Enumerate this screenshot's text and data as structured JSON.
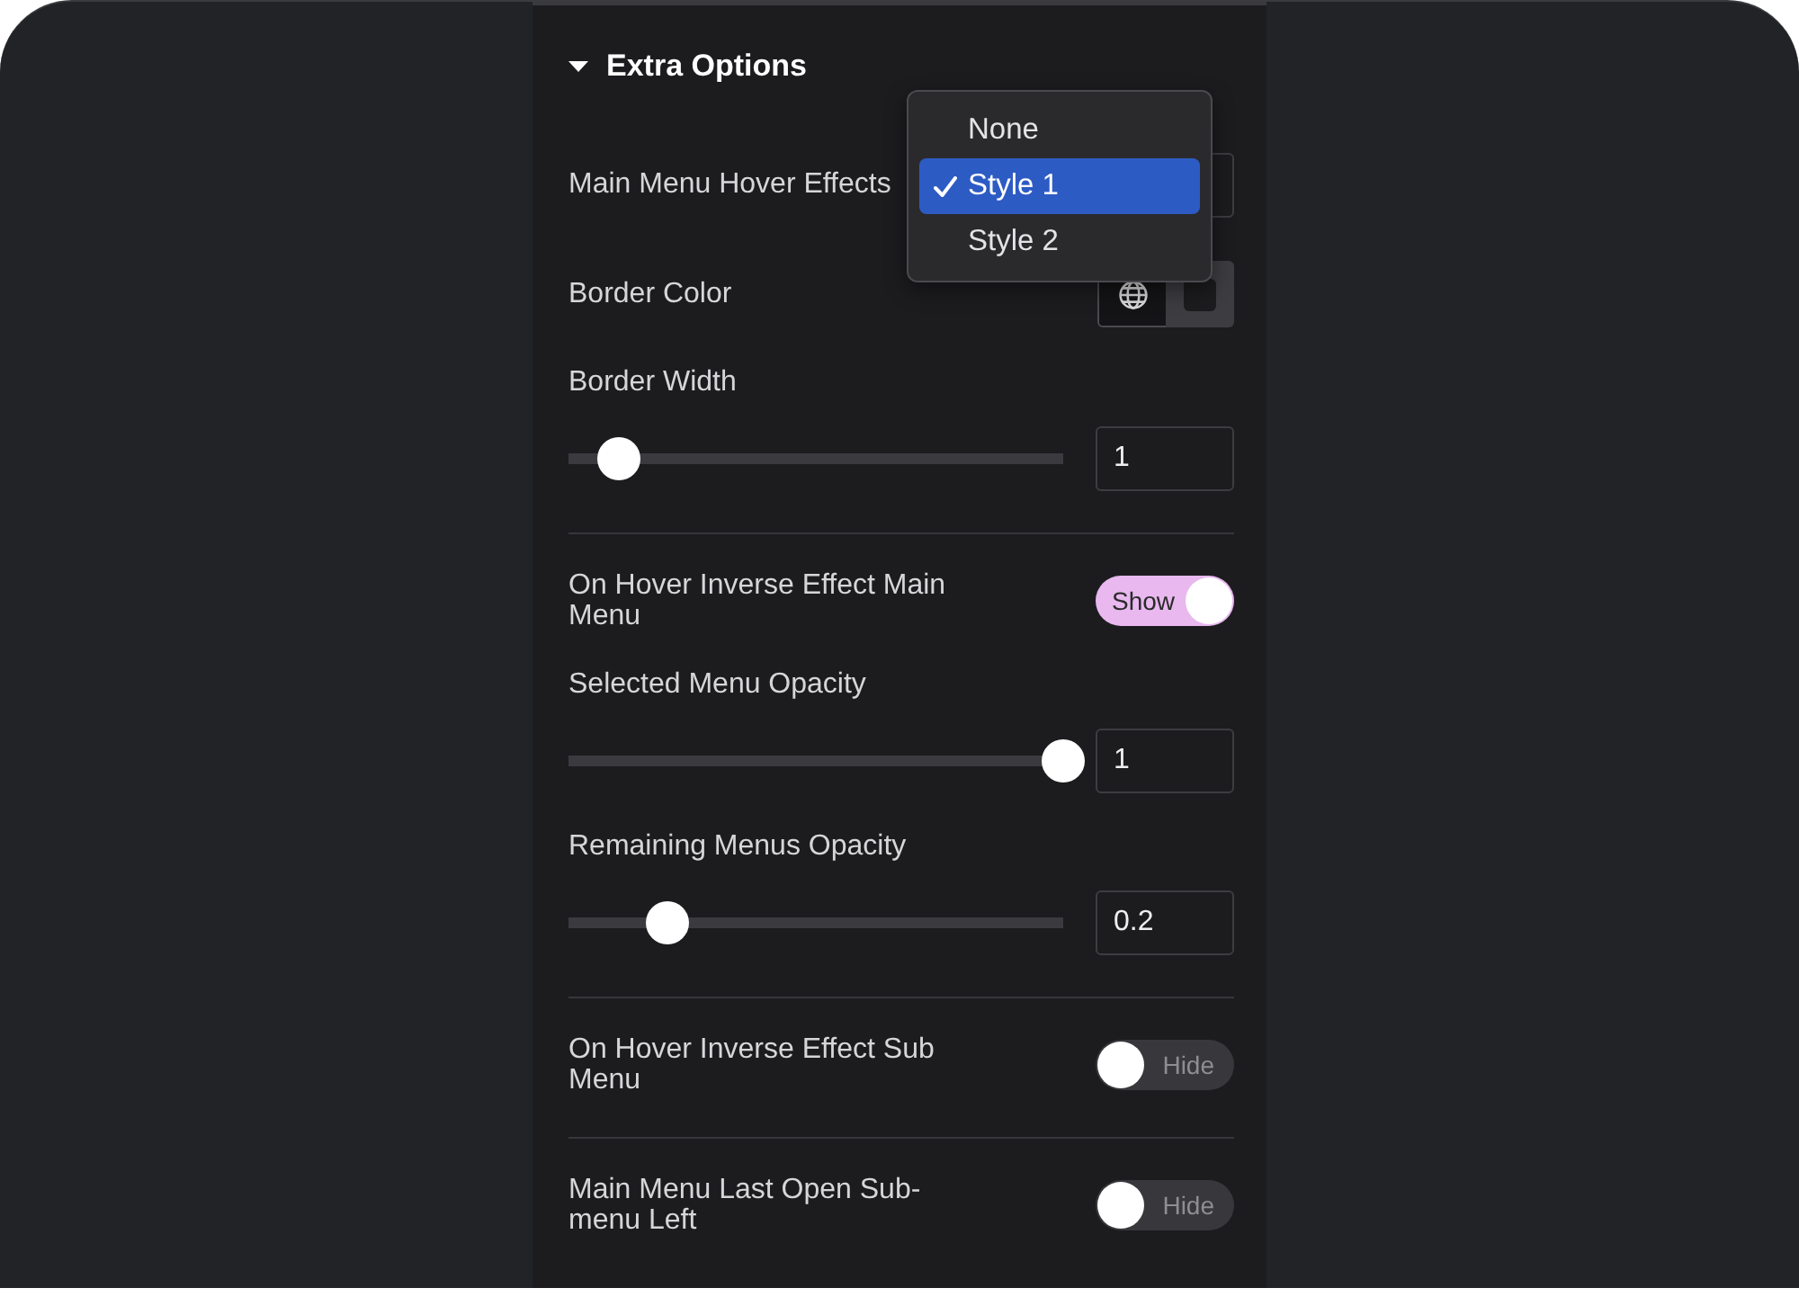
{
  "section": {
    "title": "Extra Options",
    "expanded": true
  },
  "groups": [
    {
      "controls": [
        {
          "kind": "select",
          "label": "Main Menu Hover Effects",
          "open": true,
          "options": [
            {
              "label": "None",
              "selected": false
            },
            {
              "label": "Style 1",
              "selected": true
            },
            {
              "label": "Style 2",
              "selected": false
            }
          ]
        },
        {
          "kind": "color",
          "label": "Border Color"
        },
        {
          "kind": "slider",
          "label": "Border Width",
          "level": 0.1,
          "value": "1"
        }
      ]
    },
    {
      "controls": [
        {
          "kind": "switch",
          "label": "On Hover Inverse Effect Main Menu",
          "on": true,
          "text": "Show"
        },
        {
          "kind": "slider",
          "label": "Selected Menu Opacity",
          "level": 1,
          "value": "1"
        },
        {
          "kind": "slider",
          "label": "Remaining Menus Opacity",
          "level": 0.2,
          "value": "0.2"
        }
      ]
    },
    {
      "controls": [
        {
          "kind": "switch",
          "label": "On Hover Inverse Effect Sub Menu",
          "on": false,
          "text": "Hide"
        }
      ]
    },
    {
      "controls": [
        {
          "kind": "switch",
          "label": "Main Menu Last Open Sub-menu Left",
          "on": false,
          "text": "Hide"
        }
      ]
    }
  ]
}
